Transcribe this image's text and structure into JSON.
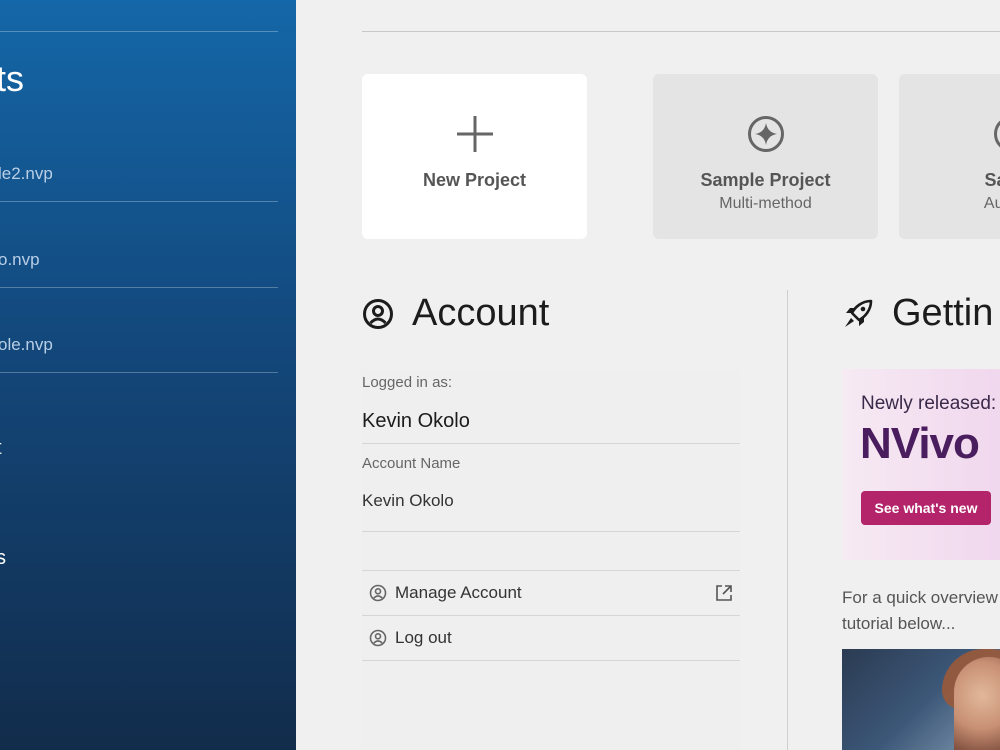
{
  "sidebar": {
    "title": "ts",
    "recent_files": [
      "le2.nvp",
      "o.nvp",
      "ole.nvp"
    ],
    "links": [
      "t",
      "s"
    ]
  },
  "cards": [
    {
      "title": "New Project",
      "subtitle": "",
      "icon": "plus-icon"
    },
    {
      "title": "Sample Project",
      "subtitle": "Multi-method",
      "icon": "sparkle-icon"
    },
    {
      "title": "Sampl",
      "subtitle": "Automa",
      "icon": "circle-icon"
    }
  ],
  "account": {
    "heading": "Account",
    "logged_in_label": "Logged in as:",
    "user_name": "Kevin Okolo",
    "account_name_label": "Account Name",
    "account_name_value": "Kevin Okolo",
    "manage_label": "Manage Account",
    "logout_label": "Log out"
  },
  "getting_started": {
    "heading": "Gettin",
    "banner_prefix": "Newly released:",
    "banner_logo": "NVivo",
    "banner_button": "See what's new",
    "overview_text": "For a quick overview tutorial below..."
  },
  "colors": {
    "sidebar_top": "#1467a8",
    "sidebar_bottom": "#122c4b",
    "banner_button": "#b3246a",
    "logo_text": "#4a1d5e"
  }
}
